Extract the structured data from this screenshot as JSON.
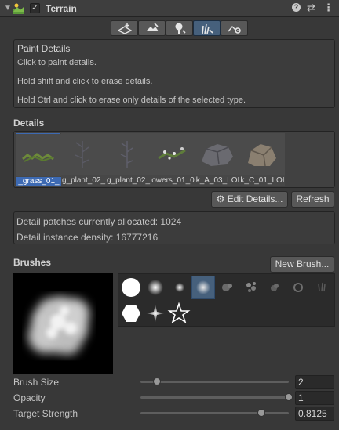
{
  "header": {
    "title": "Terrain"
  },
  "toolbar": {
    "tools": [
      "raise-lower-icon",
      "paint-texture-icon",
      "paint-trees-icon",
      "paint-details-icon",
      "terrain-settings-icon"
    ],
    "selected": 3
  },
  "paint_details": {
    "title": "Paint Details",
    "line1": "Click to paint details.",
    "line2": "Hold shift and click to erase details.",
    "line3": "Hold Ctrl and click to erase only details of the selected type."
  },
  "details": {
    "section_title": "Details",
    "items": [
      "_grass_01_",
      "g_plant_02_",
      "g_plant_02_",
      "owers_01_0",
      "k_A_03_LOI",
      "k_C_01_LOI"
    ],
    "edit_button": "Edit Details...",
    "refresh_button": "Refresh"
  },
  "stats": {
    "patches": "Detail patches currently allocated: 1024",
    "density": "Detail instance density: 16777216"
  },
  "brushes": {
    "section_title": "Brushes",
    "new_brush_button": "New Brush..."
  },
  "settings": {
    "brush_size_label": "Brush Size",
    "brush_size_value": "2",
    "brush_size_fraction": 0.11,
    "opacity_label": "Opacity",
    "opacity_value": "1",
    "opacity_fraction": 1.0,
    "strength_label": "Target Strength",
    "strength_value": "0.8125",
    "strength_fraction": 0.8125
  },
  "colors": {
    "accent": "#46607c",
    "selection": "#3d6ab3",
    "background": "#383838"
  }
}
